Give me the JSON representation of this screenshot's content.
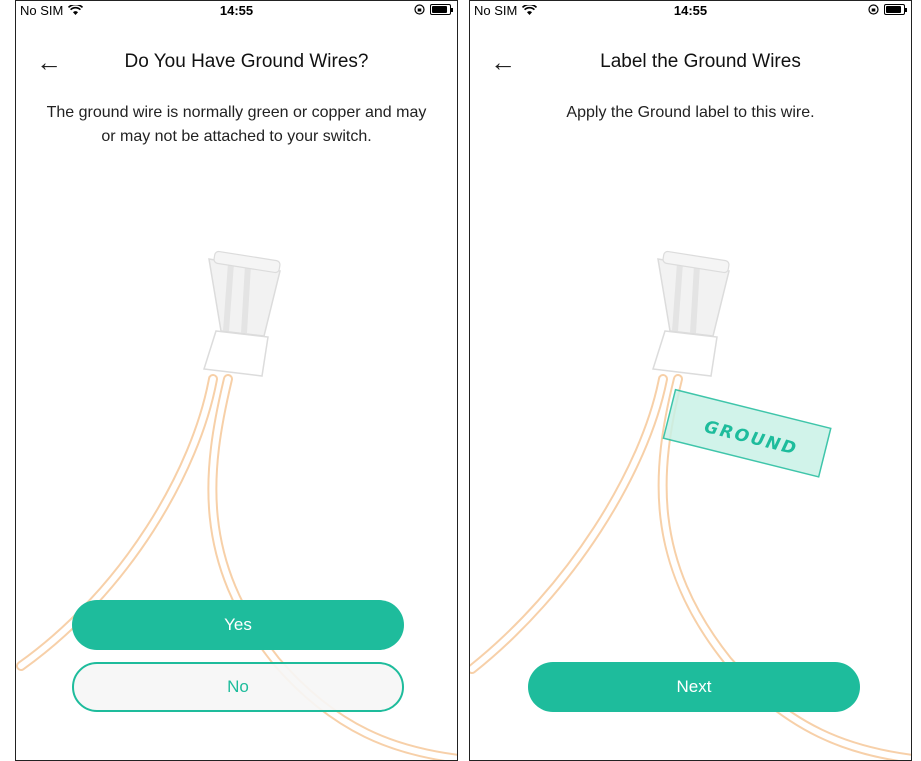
{
  "left": {
    "status": {
      "carrier": "No SIM",
      "time": "14:55"
    },
    "title": "Do You Have Ground Wires?",
    "description": "The ground wire is normally green or copper and may or may not be attached to your switch.",
    "yes_label": "Yes",
    "no_label": "No"
  },
  "right": {
    "status": {
      "carrier": "No SIM",
      "time": "14:55"
    },
    "title": "Label the Ground Wires",
    "description": "Apply the Ground label to this wire.",
    "tag_text": "GROUND",
    "next_label": "Next"
  },
  "colors": {
    "accent": "#1ebc9c",
    "wire": "#f6c89a"
  },
  "icons": {
    "back": "back-arrow-icon",
    "wifi": "wifi-icon",
    "orientation_lock": "orientation-lock-icon",
    "battery": "battery-icon"
  }
}
